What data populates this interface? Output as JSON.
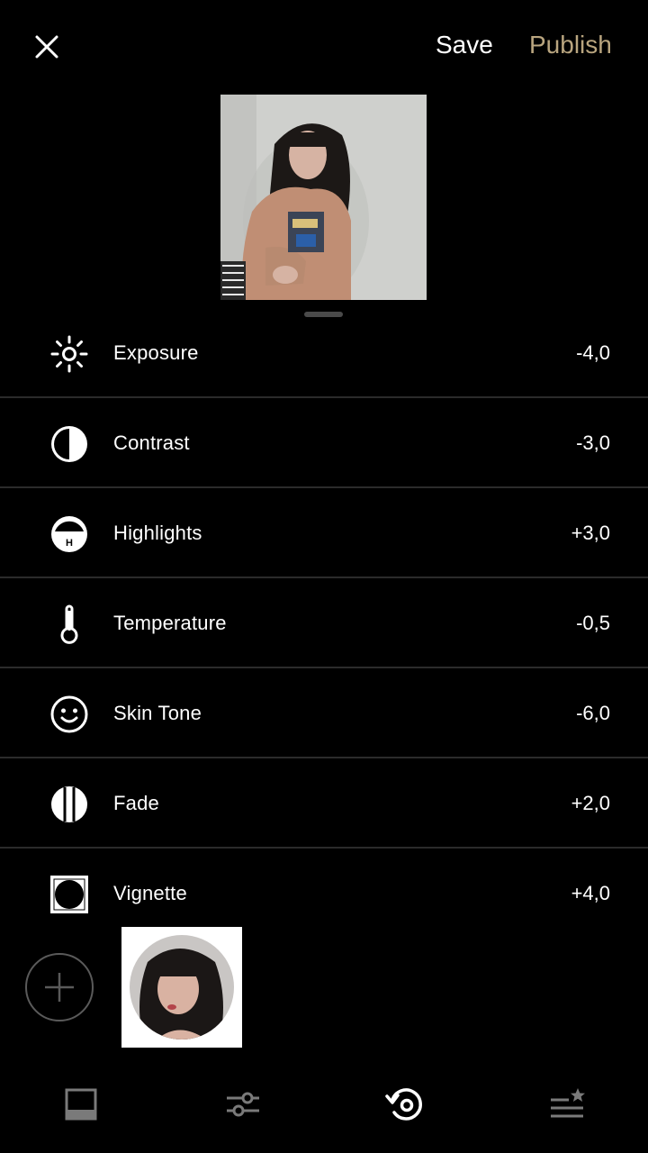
{
  "header": {
    "close_icon": "close-icon",
    "save_label": "Save",
    "publish_label": "Publish",
    "publish_color": "#b9a57f"
  },
  "adjustments": [
    {
      "icon": "exposure-sun-icon",
      "label": "Exposure",
      "value": "-4,0"
    },
    {
      "icon": "contrast-icon",
      "label": "Contrast",
      "value": "-3,0"
    },
    {
      "icon": "highlights-icon",
      "label": "Highlights",
      "value": "+3,0"
    },
    {
      "icon": "temperature-thermometer-icon",
      "label": "Temperature",
      "value": "-0,5"
    },
    {
      "icon": "skin-tone-face-icon",
      "label": "Skin Tone",
      "value": "-6,0"
    },
    {
      "icon": "fade-icon",
      "label": "Fade",
      "value": "+2,0"
    },
    {
      "icon": "vignette-icon",
      "label": "Vignette",
      "value": "+4,0"
    }
  ],
  "highlights_badge": "H",
  "recipes": {
    "add_icon": "plus-icon"
  },
  "toolbar": {
    "items": [
      {
        "icon": "presets-icon",
        "active": false
      },
      {
        "icon": "sliders-icon",
        "active": false
      },
      {
        "icon": "history-rotate-icon",
        "active": true
      },
      {
        "icon": "recipes-star-list-icon",
        "active": false
      }
    ],
    "active_color": "#ffffff",
    "inactive_color": "#7a7a7a"
  }
}
